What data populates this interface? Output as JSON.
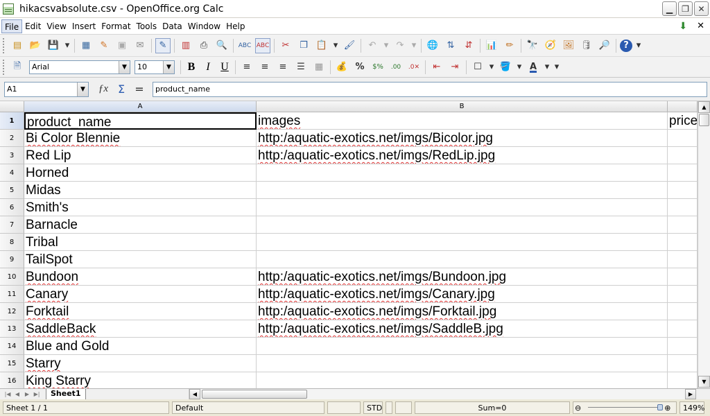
{
  "window": {
    "title": "hikacsvabsolute.csv - OpenOffice.org Calc"
  },
  "menu": [
    "File",
    "Edit",
    "View",
    "Insert",
    "Format",
    "Tools",
    "Data",
    "Window",
    "Help"
  ],
  "toolbar2": {
    "font_name": "Arial",
    "font_size": "10",
    "bold": "B",
    "italic": "I",
    "underline": "U"
  },
  "formula_bar": {
    "name_box": "A1",
    "content": "product_name"
  },
  "columns": [
    "A",
    "B"
  ],
  "rows": [
    {
      "num": "1",
      "a": "product_name",
      "b": "images",
      "c": "price"
    },
    {
      "num": "2",
      "a": "Bi Color Blennie",
      "b": "http:/aquatic-exotics.net/imgs/Bicolor.jpg",
      "c": ""
    },
    {
      "num": "3",
      "a": "Red Lip",
      "b": "http:/aquatic-exotics.net/imgs/RedLip.jpg",
      "c": ""
    },
    {
      "num": "4",
      "a": "Horned",
      "b": "",
      "c": ""
    },
    {
      "num": "5",
      "a": "Midas",
      "b": "",
      "c": ""
    },
    {
      "num": "6",
      "a": "Smith's",
      "b": "",
      "c": ""
    },
    {
      "num": "7",
      "a": "Barnacle",
      "b": "",
      "c": ""
    },
    {
      "num": "8",
      "a": "Tribal",
      "b": "",
      "c": ""
    },
    {
      "num": "9",
      "a": "TailSpot",
      "b": "",
      "c": ""
    },
    {
      "num": "10",
      "a": "Bundoon",
      "b": "http:/aquatic-exotics.net/imgs/Bundoon.jpg",
      "c": ""
    },
    {
      "num": "11",
      "a": "Canary",
      "b": "http:/aquatic-exotics.net/imgs/Canary.jpg",
      "c": ""
    },
    {
      "num": "12",
      "a": "Forktail",
      "b": "http:/aquatic-exotics.net/imgs/Forktail.jpg",
      "c": ""
    },
    {
      "num": "13",
      "a": "SaddleBack",
      "b": "http:/aquatic-exotics.net/imgs/SaddleB.jpg",
      "c": ""
    },
    {
      "num": "14",
      "a": "Blue and Gold",
      "b": "",
      "c": ""
    },
    {
      "num": "15",
      "a": "Starry",
      "b": "",
      "c": ""
    },
    {
      "num": "16",
      "a": "King Starry",
      "b": "",
      "c": ""
    }
  ],
  "spellcheck_a": [
    "Bi Color Blennie",
    "Canary",
    "SaddleBack",
    "Bundoon",
    "Forktail",
    "Starry",
    "King Starry"
  ],
  "sheet_tab": "Sheet1",
  "status": {
    "sheet": "Sheet 1 / 1",
    "style": "Default",
    "mode": "STD",
    "sum": "Sum=0",
    "zoom": "149%"
  },
  "zoom_level": 149
}
